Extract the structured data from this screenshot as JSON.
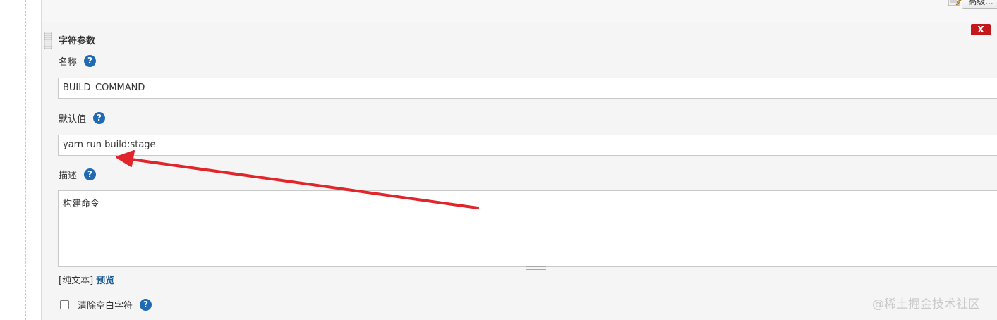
{
  "header": {
    "advanced_button_label": "高级..."
  },
  "param_section": {
    "title": "字符参数",
    "close_label": "X",
    "name": {
      "label": "名称",
      "value": "BUILD_COMMAND"
    },
    "default_value": {
      "label": "默认值",
      "value": "yarn run build:stage"
    },
    "description": {
      "label": "描述",
      "value": "构建命令"
    },
    "format": {
      "prefix": "[纯文本]",
      "preview_link": "预览"
    },
    "trim": {
      "label": "清除空白字符",
      "checked": false
    },
    "help_icon_glyph": "?"
  },
  "annotation": {
    "arrow_color": "#e0252b"
  },
  "watermark": "@稀土掘金技术社区",
  "colors": {
    "help_icon": "#1f6ab3",
    "close_button": "#c4191c",
    "preview_link": "#1f5f9a"
  }
}
